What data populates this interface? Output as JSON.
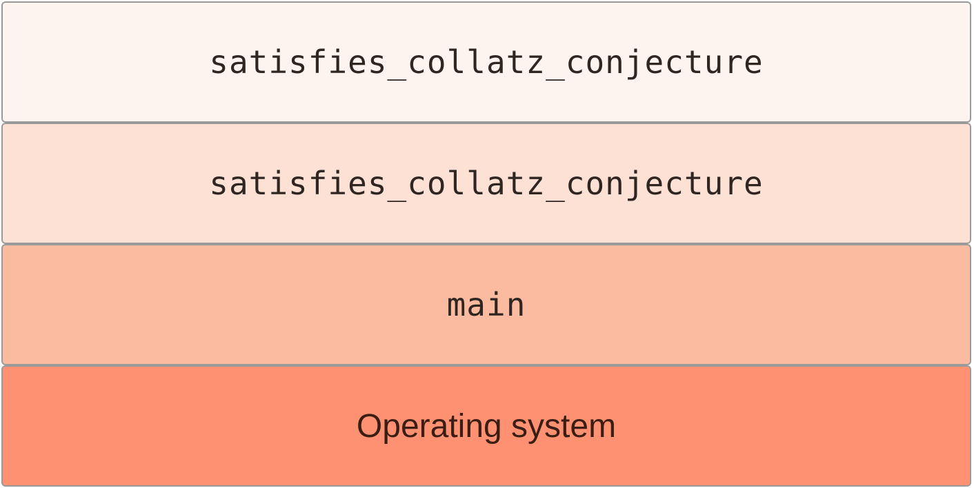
{
  "stack": {
    "frames": [
      {
        "label": "satisfies_collatz_conjecture",
        "fill": "#fef4ef"
      },
      {
        "label": "satisfies_collatz_conjecture",
        "fill": "#fde1d5"
      },
      {
        "label": "main",
        "fill": "#fbbba0"
      },
      {
        "label": "Operating system",
        "fill": "#fe9171"
      }
    ]
  },
  "colors": {
    "border": "#9a9a9a",
    "text": "#2f2622"
  }
}
